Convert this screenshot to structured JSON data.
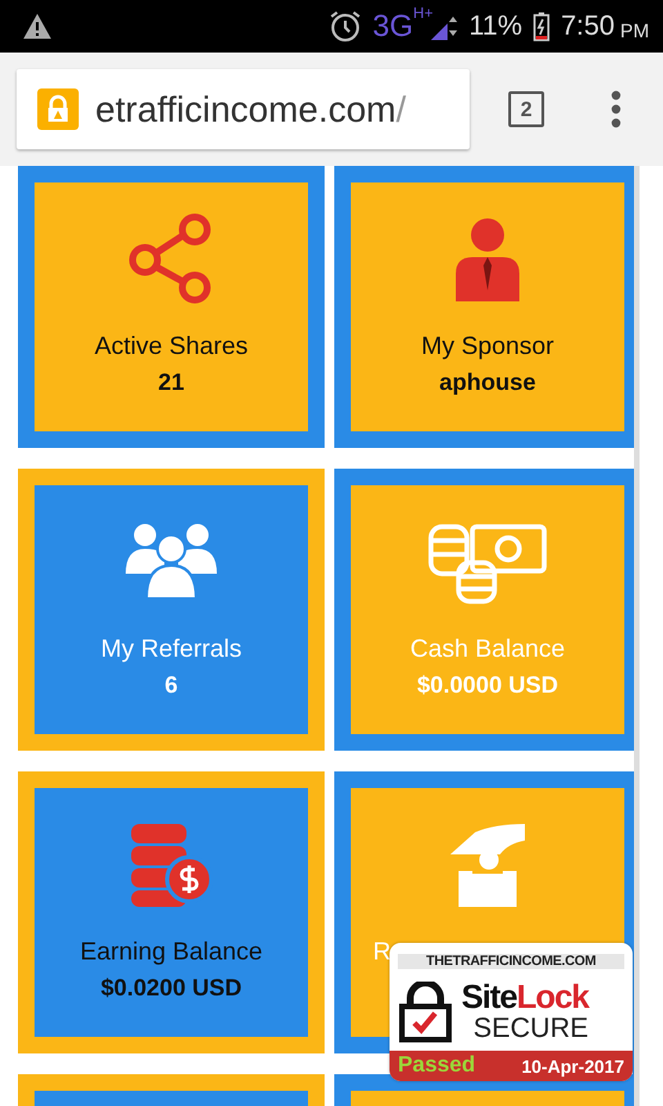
{
  "status_bar": {
    "network": "3G",
    "network_sub": "H+",
    "battery": "11%",
    "time": "7:50",
    "period": "PM"
  },
  "browser": {
    "host": "etrafficincome.com",
    "path": "/",
    "tab_count": "2"
  },
  "tiles": [
    {
      "kind": "shares",
      "color": "#fbb616",
      "light_text": false,
      "label": "Active Shares",
      "value": "21"
    },
    {
      "kind": "sponsor",
      "color": "#fbb616",
      "light_text": false,
      "label": "My Sponsor",
      "value": "aphouse"
    },
    {
      "kind": "referrals",
      "color": "#2a8be6",
      "light_text": true,
      "label": "My Referrals",
      "value": "6"
    },
    {
      "kind": "cash",
      "color": "#fbb616",
      "light_text": true,
      "label": "Cash Balance",
      "value": "$0.0000 USD"
    },
    {
      "kind": "earning",
      "color": "#2a8be6",
      "light_text": false,
      "label": "Earning Balance",
      "value": "$0.0200 USD"
    },
    {
      "kind": "deposit",
      "color": "#fbb616",
      "light_text": true,
      "label": "R"
    },
    {
      "kind": "blank",
      "color": "#2a8be6"
    },
    {
      "kind": "blank",
      "color": "#fbb616"
    }
  ],
  "badge": {
    "site": "THETRAFFICINCOME.COM",
    "brand_a": "Site",
    "brand_b": "Lock",
    "secure": "SECURE",
    "status": "Passed",
    "date": "10-Apr-2017"
  }
}
